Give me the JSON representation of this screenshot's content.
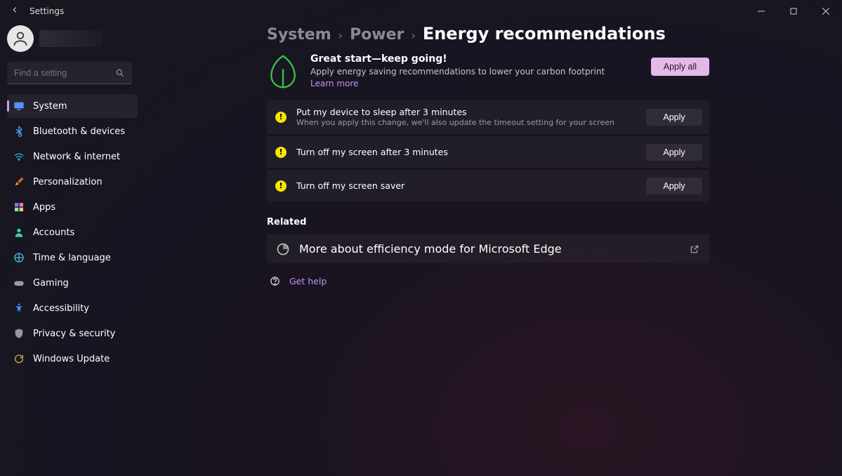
{
  "titlebar": {
    "back": "←",
    "title": "Settings"
  },
  "search": {
    "placeholder": "Find a setting"
  },
  "nav": {
    "items": [
      {
        "label": "System"
      },
      {
        "label": "Bluetooth & devices"
      },
      {
        "label": "Network & internet"
      },
      {
        "label": "Personalization"
      },
      {
        "label": "Apps"
      },
      {
        "label": "Accounts"
      },
      {
        "label": "Time & language"
      },
      {
        "label": "Gaming"
      },
      {
        "label": "Accessibility"
      },
      {
        "label": "Privacy & security"
      },
      {
        "label": "Windows Update"
      }
    ]
  },
  "breadcrumb": {
    "level0": "System",
    "level1": "Power",
    "current": "Energy recommendations"
  },
  "hero": {
    "title": "Great start—keep going!",
    "subtitle": "Apply energy saving recommendations to lower your carbon footprint",
    "learn_more": "Learn more",
    "apply_all": "Apply all"
  },
  "recommendations": [
    {
      "title": "Put my device to sleep after 3 minutes",
      "desc": "When you apply this change, we'll also update the timeout setting for your screen",
      "apply": "Apply"
    },
    {
      "title": "Turn off my screen after 3 minutes",
      "desc": "",
      "apply": "Apply"
    },
    {
      "title": "Turn off my screen saver",
      "desc": "",
      "apply": "Apply"
    }
  ],
  "related": {
    "label": "Related",
    "item": "More about efficiency mode for Microsoft Edge"
  },
  "help": {
    "label": "Get help"
  }
}
